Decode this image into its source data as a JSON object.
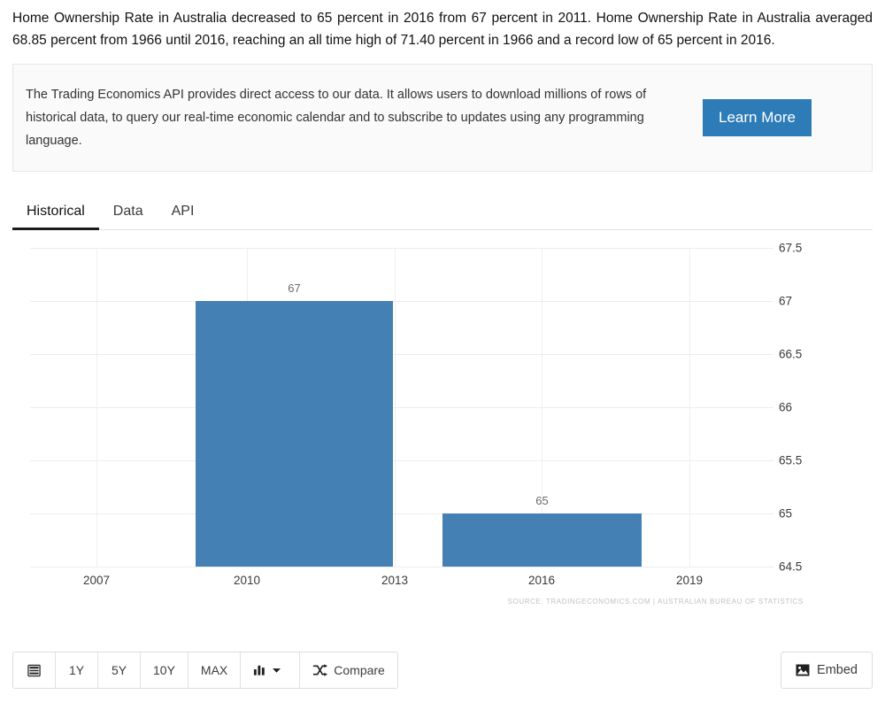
{
  "intro": {
    "text": "Home Ownership Rate in Australia decreased to 65 percent in 2016 from 67 percent in 2011. Home Ownership Rate in Australia averaged 68.85 percent from 1966 until 2016, reaching an all time high of 71.40 percent in 1966 and a record low of 65 percent in 2016."
  },
  "api_box": {
    "text": "The Trading Economics API provides direct access to our data. It allows users to download millions of rows of historical data, to query our real-time economic calendar and to subscribe to updates using any programming language.",
    "button_label": "Learn More",
    "button_color": "#2d7cb8"
  },
  "tabs": [
    {
      "label": "Historical",
      "active": true
    },
    {
      "label": "Data",
      "active": false
    },
    {
      "label": "API",
      "active": false
    }
  ],
  "chart_data": {
    "type": "bar",
    "title": "",
    "xlabel": "",
    "ylabel": "",
    "categories": [
      "2011",
      "2016"
    ],
    "values": [
      67,
      65
    ],
    "data_labels": [
      "67",
      "65"
    ],
    "series": [
      {
        "name": "Home Ownership Rate",
        "values": [
          67,
          65
        ]
      }
    ],
    "bar_color": "#4580b4",
    "ylim": [
      64.5,
      67.5
    ],
    "yticks": [
      "67.5",
      "67",
      "66.5",
      "66",
      "65.5",
      "65",
      "64.5"
    ],
    "xticks": [
      "2007",
      "2010",
      "2013",
      "2016",
      "2019"
    ],
    "grid": true,
    "legend": "none",
    "source_note": "SOURCE: TRADINGECONOMICS.COM | AUSTRALIAN BUREAU OF STATISTICS"
  },
  "toolbar": {
    "calendar_icon": "calendar-icon",
    "ranges": [
      "1Y",
      "5Y",
      "10Y",
      "MAX"
    ],
    "chart_type_label": "",
    "compare_label": "Compare",
    "embed_label": "Embed"
  }
}
